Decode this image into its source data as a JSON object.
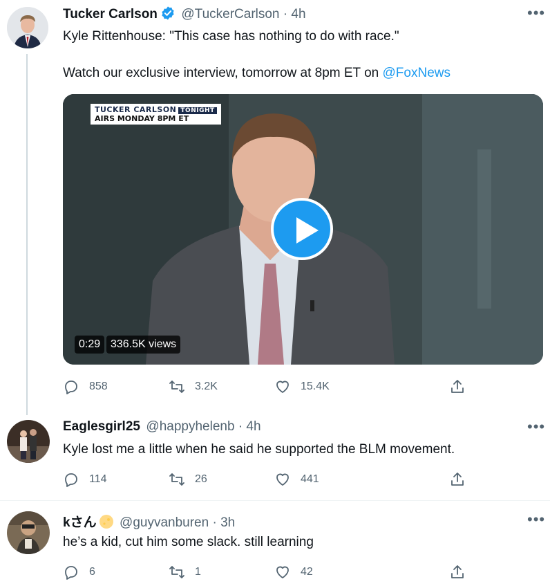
{
  "main_tweet": {
    "author_name": "Tucker Carlson",
    "handle_time": "@TuckerCarlson · 4h",
    "text_line1": "Kyle Rittenhouse: \"This case has nothing to do with race.\"",
    "text_line2_prefix": "Watch our exclusive interview, tomorrow at 8pm ET on ",
    "text_line2_link": "@FoxNews",
    "video": {
      "banner_line1": "TUCKER CARLSON",
      "banner_tag": "TONIGHT",
      "banner_line2": "AIRS MONDAY 8PM ET",
      "duration": "0:29",
      "views": "336.5K views"
    },
    "replies": "858",
    "retweets": "3.2K",
    "likes": "15.4K"
  },
  "reply1": {
    "author_name": "Eaglesgirl25",
    "handle_time": "@happyhelenb · 4h",
    "text": "Kyle lost me a little when he said he supported the BLM movement.",
    "replies": "114",
    "retweets": "26",
    "likes": "441"
  },
  "reply2": {
    "author_name": "kさん",
    "handle_time": "@guyvanburen · 3h",
    "text": "he’s a kid, cut him some slack. still learning",
    "replies": "6",
    "retweets": "1",
    "likes": "42"
  },
  "colors": {
    "accent": "#1d9bf0",
    "secondary_text": "#536471",
    "primary_text": "#0f1419"
  }
}
